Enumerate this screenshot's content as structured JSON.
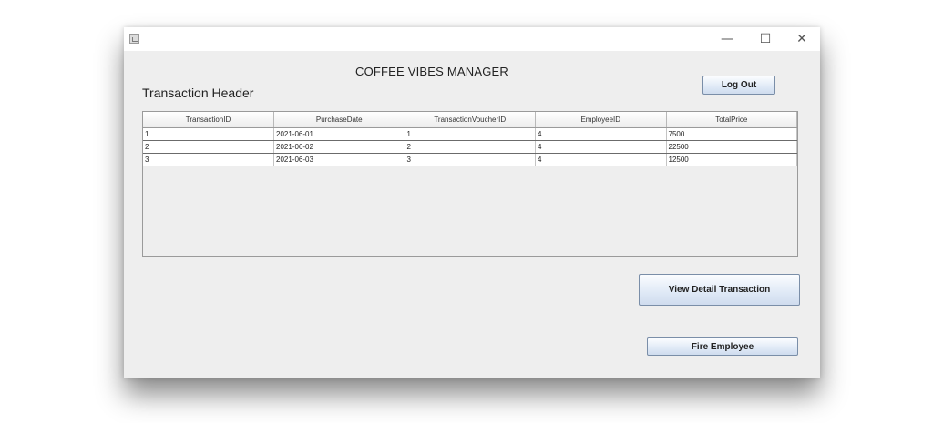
{
  "window": {
    "controls": {
      "minimize": "—",
      "maximize": "☐",
      "close": "✕"
    }
  },
  "header": {
    "app_title": "COFFEE VIBES MANAGER",
    "section_title": "Transaction Header",
    "logout_label": "Log Out"
  },
  "table": {
    "columns": [
      "TransactionID",
      "PurchaseDate",
      "TransactionVoucherID",
      "EmployeeID",
      "TotalPrice"
    ],
    "rows": [
      [
        "1",
        "2021-06-01",
        "1",
        "4",
        "7500"
      ],
      [
        "2",
        "2021-06-02",
        "2",
        "4",
        "22500"
      ],
      [
        "3",
        "2021-06-03",
        "3",
        "4",
        "12500"
      ]
    ]
  },
  "actions": {
    "view_detail_label": "View Detail Transaction",
    "fire_employee_label": "Fire Employee"
  }
}
